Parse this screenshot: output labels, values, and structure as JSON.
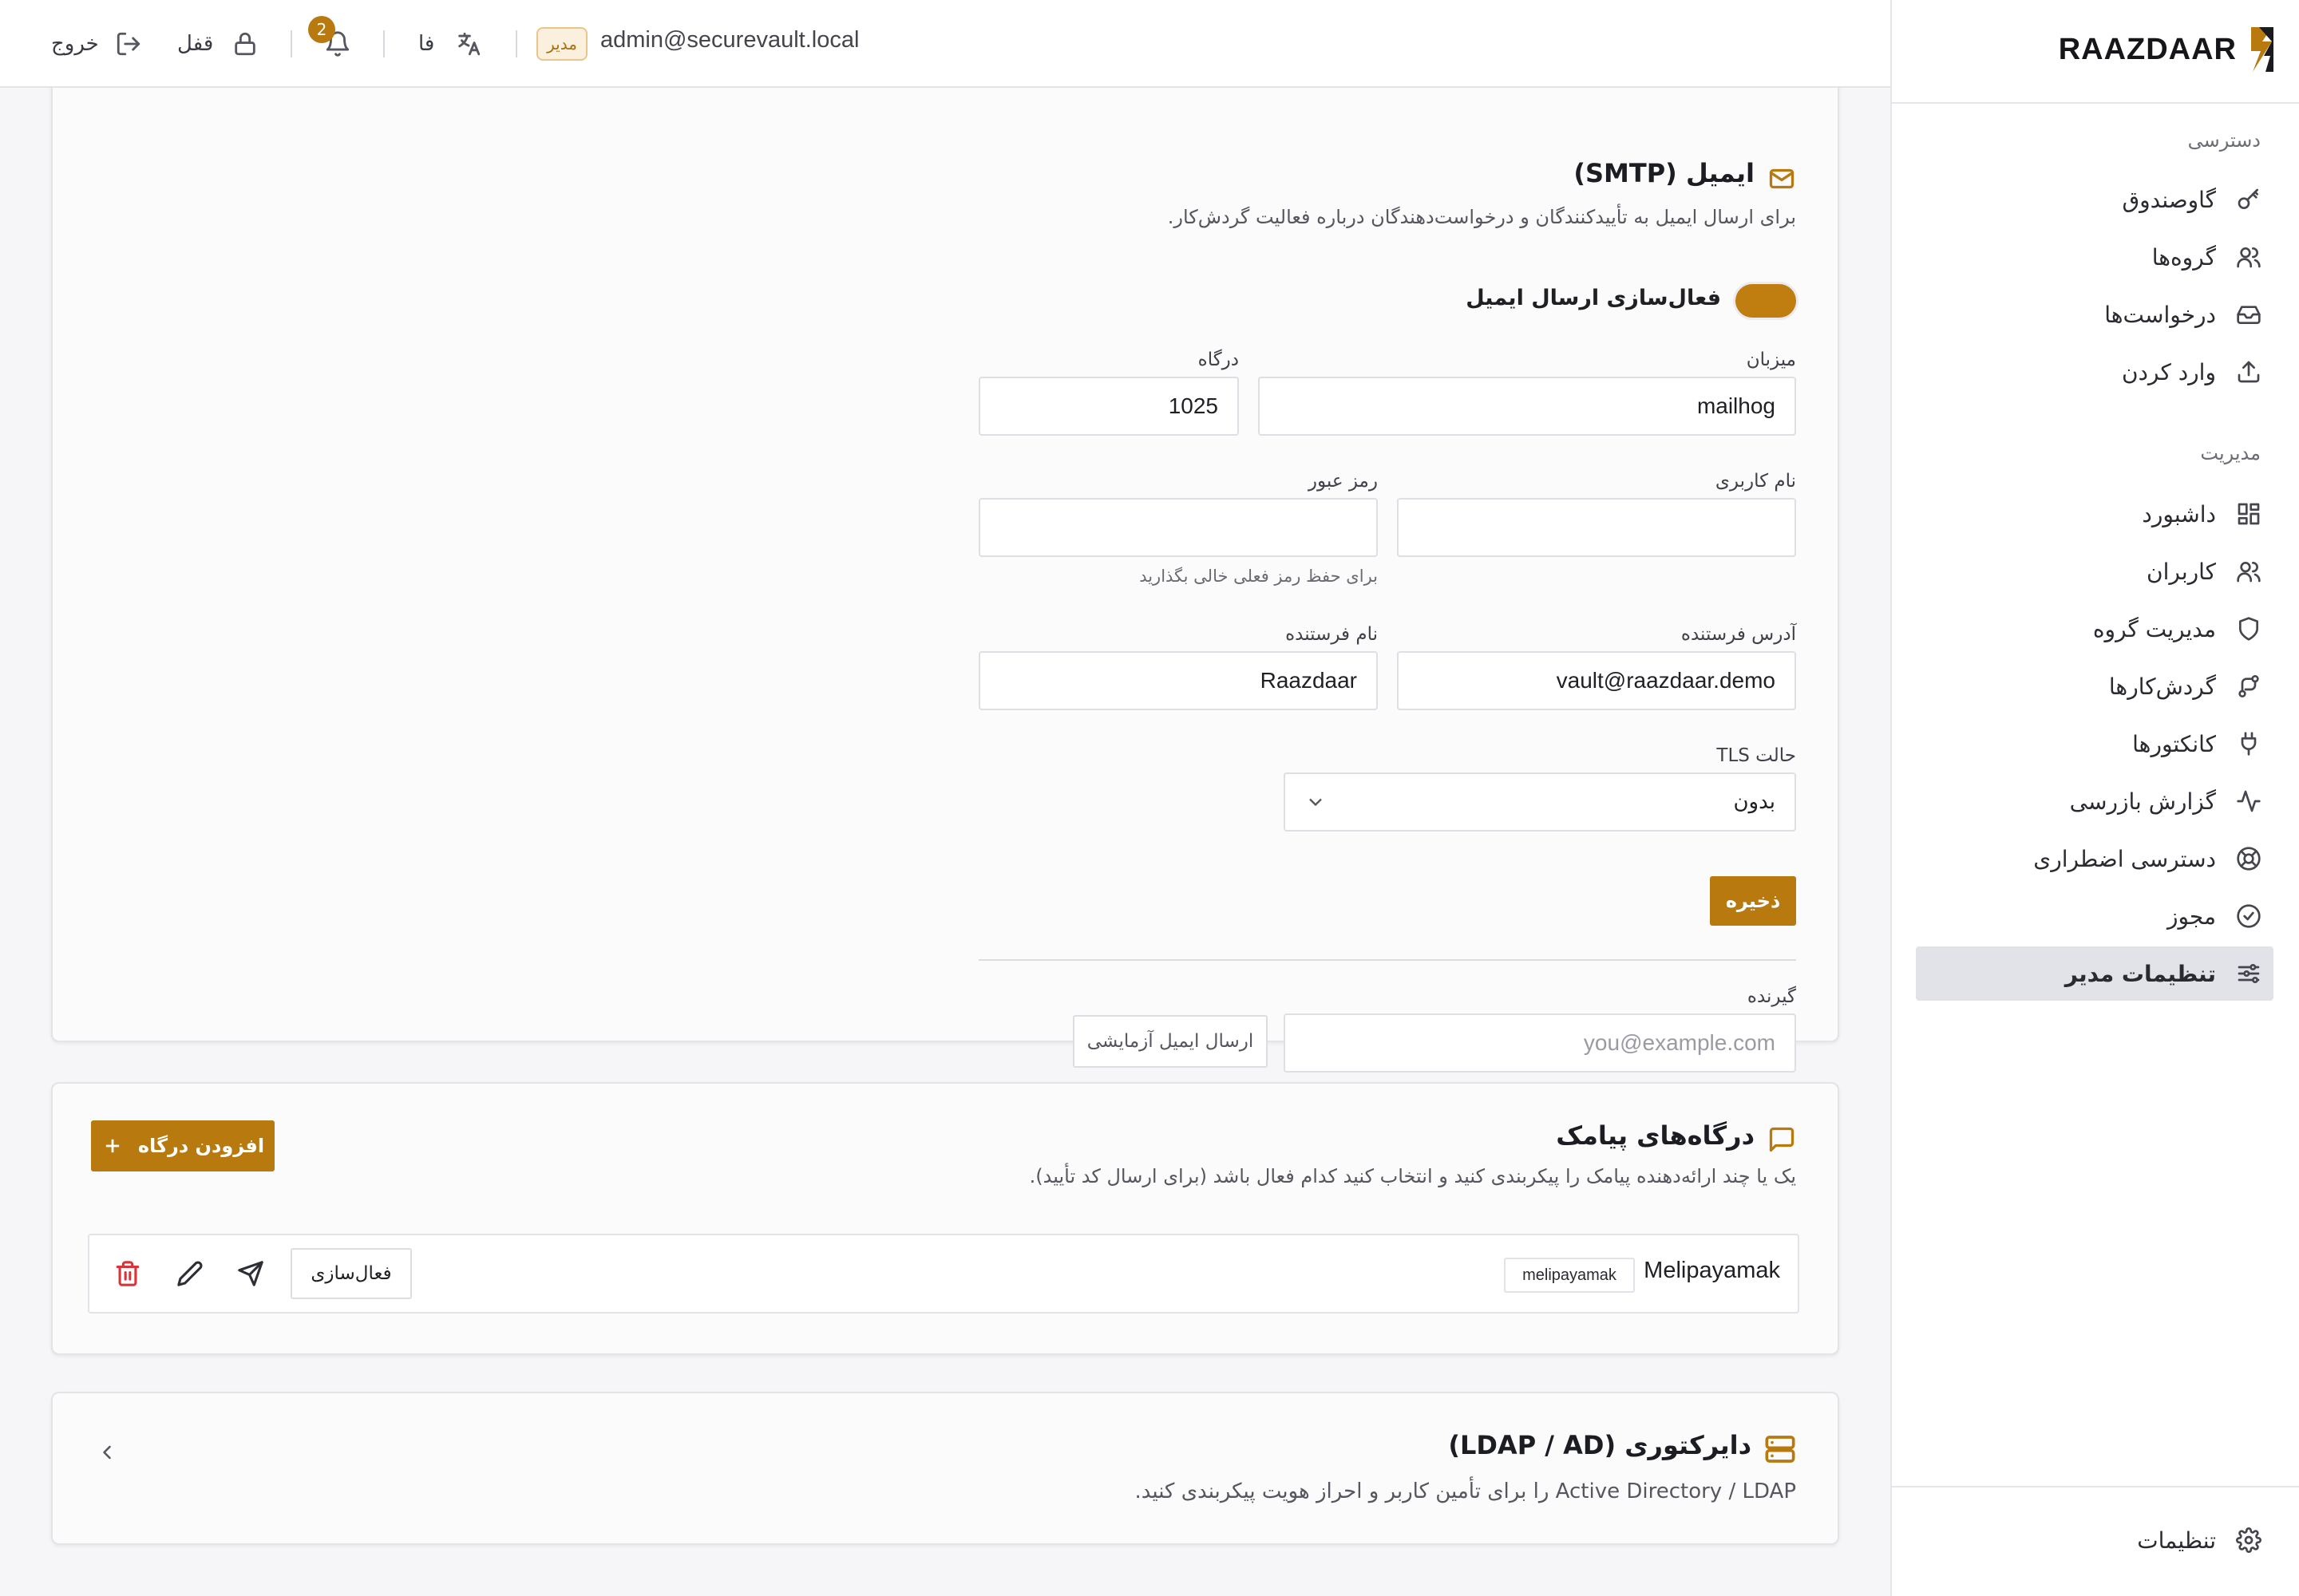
{
  "brand": {
    "name": "RAAZDAAR"
  },
  "sidebar": {
    "section_access": "دسترسی",
    "access_items": [
      {
        "label": "گاوصندوق",
        "icon": "key-icon"
      },
      {
        "label": "گروه‌ها",
        "icon": "users-icon"
      },
      {
        "label": "درخواست‌ها",
        "icon": "inbox-icon"
      },
      {
        "label": "وارد کردن",
        "icon": "upload-icon"
      }
    ],
    "section_admin": "مدیریت",
    "admin_items": [
      {
        "label": "داشبورد",
        "icon": "dashboard-icon"
      },
      {
        "label": "کاربران",
        "icon": "users-icon"
      },
      {
        "label": "مدیریت گروه",
        "icon": "shield-icon"
      },
      {
        "label": "گردش‌کارها",
        "icon": "workflow-icon"
      },
      {
        "label": "کانکتورها",
        "icon": "plug-icon"
      },
      {
        "label": "گزارش بازرسی",
        "icon": "activity-icon"
      },
      {
        "label": "دسترسی اضطراری",
        "icon": "lifebuoy-icon"
      },
      {
        "label": "مجوز",
        "icon": "badge-check-icon"
      },
      {
        "label": "تنظیمات مدیر",
        "icon": "sliders-icon",
        "active": true
      }
    ],
    "footer_settings": "تنظیمات"
  },
  "topbar": {
    "user_email": "admin@securevault.local",
    "role_badge": "مدیر",
    "language": "فا",
    "notification_count": "2",
    "lock_label": "قفل",
    "logout_label": "خروج"
  },
  "email_card": {
    "title": "ایمیل (SMTP)",
    "description": "برای ارسال ایمیل به تأییدکنندگان و درخواست‌دهندگان درباره فعالیت گردش‌کار.",
    "toggle_label": "فعال‌سازی ارسال ایمیل",
    "toggle_on": true,
    "host_label": "میزبان",
    "host_value": "mailhog",
    "port_label": "درگاه",
    "port_value": "1025",
    "username_label": "نام کاربری",
    "username_value": "",
    "password_label": "رمز عبور",
    "password_value": "",
    "password_hint": "برای حفظ رمز فعلی خالی بگذارید",
    "from_address_label": "آدرس فرستنده",
    "from_address_value": "vault@raazdaar.demo",
    "from_name_label": "نام فرستنده",
    "from_name_value": "Raazdaar",
    "tls_label": "حالت TLS",
    "tls_value": "بدون",
    "save_label": "ذخیره",
    "recipient_label": "گیرنده",
    "recipient_placeholder": "you@example.com",
    "send_test_label": "ارسال ایمیل آزمایشی"
  },
  "sms_card": {
    "title": "درگاه‌های پیامک",
    "description": "یک یا چند ارائه‌دهنده پیامک را پیکربندی کنید و انتخاب کنید کدام فعال باشد (برای ارسال کد تأیید).",
    "add_button": "افزودن درگاه",
    "gateways": [
      {
        "name": "Melipayamak",
        "type": "melipayamak",
        "activate_label": "فعال‌سازی"
      }
    ]
  },
  "ldap_card": {
    "title": "دایرکتوری (LDAP / AD)",
    "description": "Active Directory / LDAP را برای تأمین کاربر و احراز هویت پیکربندی کنید."
  },
  "colors": {
    "accent": "#b8790e",
    "danger": "#d8343a",
    "active_nav_bg": "#e2e3e8"
  }
}
